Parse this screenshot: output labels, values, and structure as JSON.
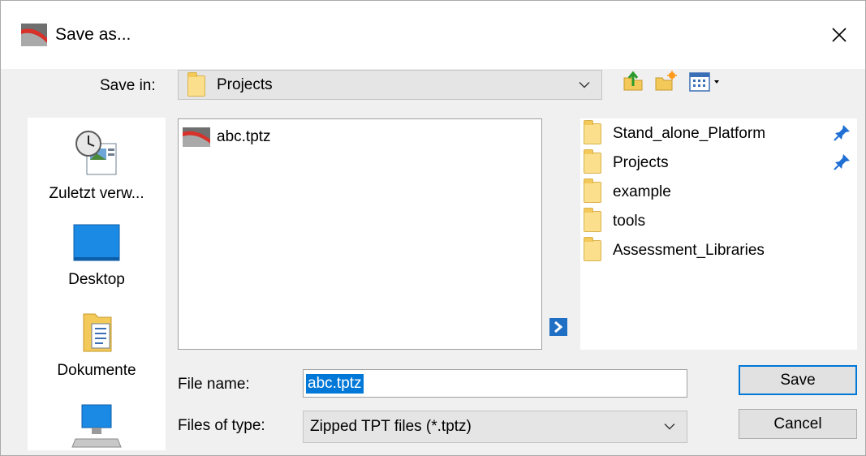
{
  "window": {
    "title": "Save as..."
  },
  "save_in": {
    "label": "Save in:",
    "value": "Projects"
  },
  "places": [
    {
      "label": "Zuletzt verw...",
      "icon": "recent-places-icon"
    },
    {
      "label": "Desktop",
      "icon": "desktop-icon"
    },
    {
      "label": "Dokumente",
      "icon": "documents-icon"
    },
    {
      "label": "",
      "icon": "computer-icon"
    }
  ],
  "files": [
    {
      "name": "abc.tptz",
      "icon": "tpt-file-icon"
    }
  ],
  "recent_folders": [
    {
      "name": "Stand_alone_Platform",
      "pinned": true
    },
    {
      "name": "Projects",
      "pinned": true
    },
    {
      "name": "example",
      "pinned": false
    },
    {
      "name": "tools",
      "pinned": false
    },
    {
      "name": "Assessment_Libraries",
      "pinned": false
    }
  ],
  "file_name": {
    "label": "File name:",
    "value": "abc.tptz"
  },
  "file_type": {
    "label": "Files of type:",
    "value": "Zipped TPT files (*.tptz)"
  },
  "buttons": {
    "save": "Save",
    "cancel": "Cancel"
  },
  "colors": {
    "accent": "#0078d7",
    "folder": "#fbdf8c",
    "arrow": "#1f6fc4"
  }
}
